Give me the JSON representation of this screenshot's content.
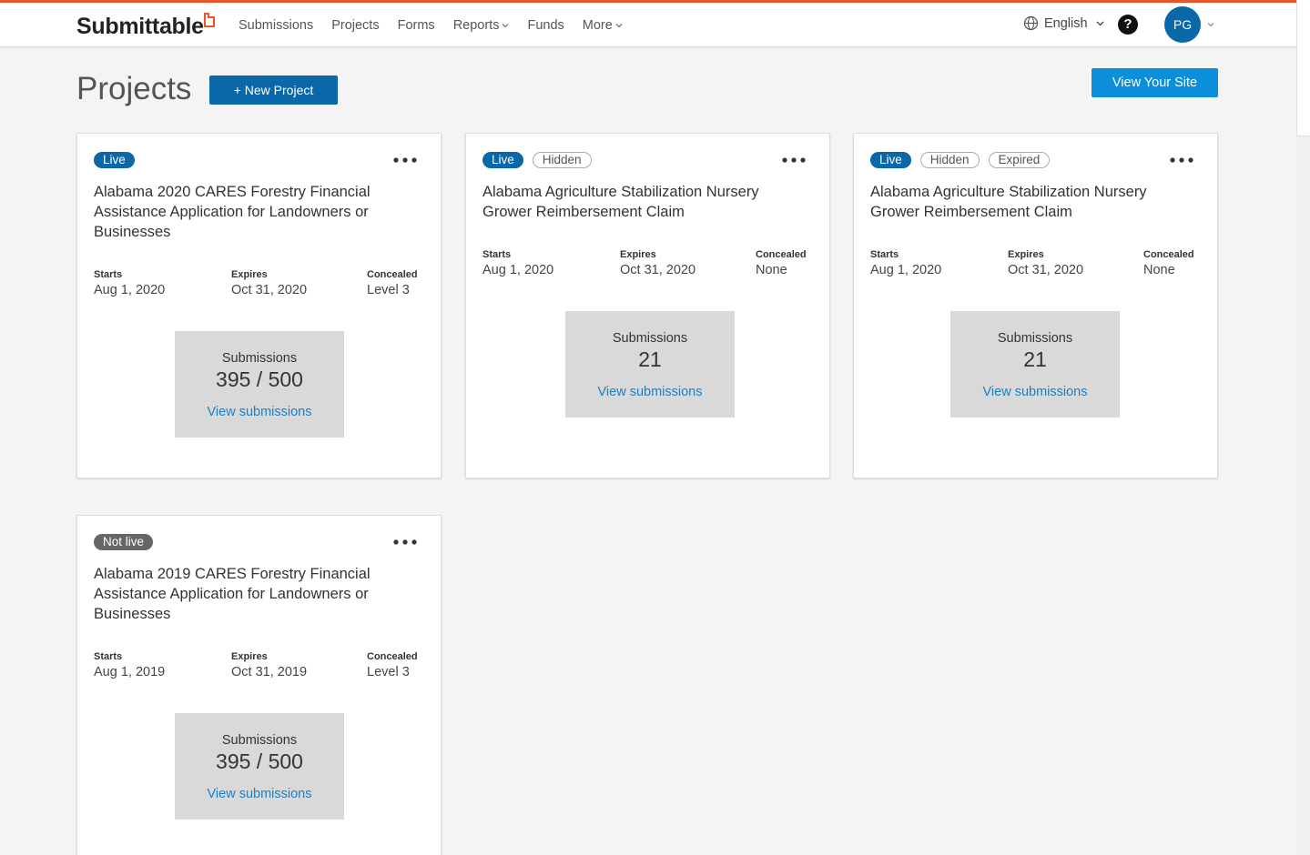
{
  "app": {
    "logo": "Submittable"
  },
  "nav": {
    "items": [
      {
        "label": "Submissions",
        "dropdown": false
      },
      {
        "label": "Projects",
        "dropdown": false
      },
      {
        "label": "Forms",
        "dropdown": false
      },
      {
        "label": "Reports",
        "dropdown": true
      },
      {
        "label": "Funds",
        "dropdown": false
      },
      {
        "label": "More",
        "dropdown": true
      }
    ]
  },
  "header": {
    "language": "English",
    "help": "?",
    "avatar": "PG"
  },
  "page": {
    "title": "Projects",
    "new_project": "+ New Project",
    "view_site": "View Your Site"
  },
  "colors": {
    "accent": "#e8562a",
    "primary": "#0a68a8",
    "site_button": "#0a8fd8",
    "link": "#1a7fc4"
  },
  "projects": [
    {
      "badges": [
        {
          "text": "Live",
          "style": "live"
        }
      ],
      "title": "Alabama 2020 CARES Forestry Financial Assistance Application for Landowners or Businesses",
      "starts_label": "Starts",
      "starts": "Aug 1, 2020",
      "expires_label": "Expires",
      "expires": "Oct 31, 2020",
      "concealed_label": "Concealed",
      "concealed": "Level 3",
      "submissions_label": "Submissions",
      "submissions": "395 / 500",
      "view_link": "View submissions"
    },
    {
      "badges": [
        {
          "text": "Live",
          "style": "live"
        },
        {
          "text": "Hidden",
          "style": "outline"
        }
      ],
      "title": "Alabama Agriculture Stabilization Nursery Grower Reimbersement Claim",
      "starts_label": "Starts",
      "starts": "Aug 1, 2020",
      "expires_label": "Expires",
      "expires": "Oct 31, 2020",
      "concealed_label": "Concealed",
      "concealed": "None",
      "submissions_label": "Submissions",
      "submissions": "21",
      "view_link": "View submissions"
    },
    {
      "badges": [
        {
          "text": "Live",
          "style": "live"
        },
        {
          "text": "Hidden",
          "style": "outline"
        },
        {
          "text": "Expired",
          "style": "outline"
        }
      ],
      "title": "Alabama Agriculture Stabilization Nursery Grower Reimbersement Claim",
      "starts_label": "Starts",
      "starts": "Aug 1, 2020",
      "expires_label": "Expires",
      "expires": "Oct 31, 2020",
      "concealed_label": "Concealed",
      "concealed": "None",
      "submissions_label": "Submissions",
      "submissions": "21",
      "view_link": "View submissions"
    },
    {
      "badges": [
        {
          "text": "Not live",
          "style": "notlive"
        }
      ],
      "title": "Alabama 2019 CARES Forestry Financial Assistance Application for Landowners or Businesses",
      "starts_label": "Starts",
      "starts": "Aug 1, 2019",
      "expires_label": "Expires",
      "expires": "Oct 31, 2019",
      "concealed_label": "Concealed",
      "concealed": "Level 3",
      "submissions_label": "Submissions",
      "submissions": "395 / 500",
      "view_link": "View submissions"
    }
  ]
}
